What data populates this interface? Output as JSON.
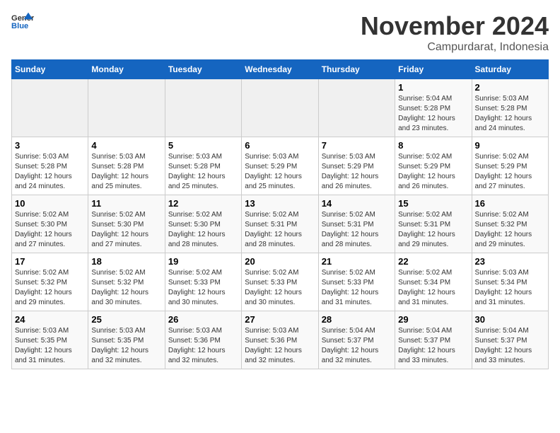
{
  "logo": {
    "line1": "General",
    "line2": "Blue"
  },
  "header": {
    "month": "November 2024",
    "location": "Campurdarat, Indonesia"
  },
  "weekdays": [
    "Sunday",
    "Monday",
    "Tuesday",
    "Wednesday",
    "Thursday",
    "Friday",
    "Saturday"
  ],
  "weeks": [
    [
      {
        "day": "",
        "info": ""
      },
      {
        "day": "",
        "info": ""
      },
      {
        "day": "",
        "info": ""
      },
      {
        "day": "",
        "info": ""
      },
      {
        "day": "",
        "info": ""
      },
      {
        "day": "1",
        "info": "Sunrise: 5:04 AM\nSunset: 5:28 PM\nDaylight: 12 hours and 23 minutes."
      },
      {
        "day": "2",
        "info": "Sunrise: 5:03 AM\nSunset: 5:28 PM\nDaylight: 12 hours and 24 minutes."
      }
    ],
    [
      {
        "day": "3",
        "info": "Sunrise: 5:03 AM\nSunset: 5:28 PM\nDaylight: 12 hours and 24 minutes."
      },
      {
        "day": "4",
        "info": "Sunrise: 5:03 AM\nSunset: 5:28 PM\nDaylight: 12 hours and 25 minutes."
      },
      {
        "day": "5",
        "info": "Sunrise: 5:03 AM\nSunset: 5:28 PM\nDaylight: 12 hours and 25 minutes."
      },
      {
        "day": "6",
        "info": "Sunrise: 5:03 AM\nSunset: 5:29 PM\nDaylight: 12 hours and 25 minutes."
      },
      {
        "day": "7",
        "info": "Sunrise: 5:03 AM\nSunset: 5:29 PM\nDaylight: 12 hours and 26 minutes."
      },
      {
        "day": "8",
        "info": "Sunrise: 5:02 AM\nSunset: 5:29 PM\nDaylight: 12 hours and 26 minutes."
      },
      {
        "day": "9",
        "info": "Sunrise: 5:02 AM\nSunset: 5:29 PM\nDaylight: 12 hours and 27 minutes."
      }
    ],
    [
      {
        "day": "10",
        "info": "Sunrise: 5:02 AM\nSunset: 5:30 PM\nDaylight: 12 hours and 27 minutes."
      },
      {
        "day": "11",
        "info": "Sunrise: 5:02 AM\nSunset: 5:30 PM\nDaylight: 12 hours and 27 minutes."
      },
      {
        "day": "12",
        "info": "Sunrise: 5:02 AM\nSunset: 5:30 PM\nDaylight: 12 hours and 28 minutes."
      },
      {
        "day": "13",
        "info": "Sunrise: 5:02 AM\nSunset: 5:31 PM\nDaylight: 12 hours and 28 minutes."
      },
      {
        "day": "14",
        "info": "Sunrise: 5:02 AM\nSunset: 5:31 PM\nDaylight: 12 hours and 28 minutes."
      },
      {
        "day": "15",
        "info": "Sunrise: 5:02 AM\nSunset: 5:31 PM\nDaylight: 12 hours and 29 minutes."
      },
      {
        "day": "16",
        "info": "Sunrise: 5:02 AM\nSunset: 5:32 PM\nDaylight: 12 hours and 29 minutes."
      }
    ],
    [
      {
        "day": "17",
        "info": "Sunrise: 5:02 AM\nSunset: 5:32 PM\nDaylight: 12 hours and 29 minutes."
      },
      {
        "day": "18",
        "info": "Sunrise: 5:02 AM\nSunset: 5:32 PM\nDaylight: 12 hours and 30 minutes."
      },
      {
        "day": "19",
        "info": "Sunrise: 5:02 AM\nSunset: 5:33 PM\nDaylight: 12 hours and 30 minutes."
      },
      {
        "day": "20",
        "info": "Sunrise: 5:02 AM\nSunset: 5:33 PM\nDaylight: 12 hours and 30 minutes."
      },
      {
        "day": "21",
        "info": "Sunrise: 5:02 AM\nSunset: 5:33 PM\nDaylight: 12 hours and 31 minutes."
      },
      {
        "day": "22",
        "info": "Sunrise: 5:02 AM\nSunset: 5:34 PM\nDaylight: 12 hours and 31 minutes."
      },
      {
        "day": "23",
        "info": "Sunrise: 5:03 AM\nSunset: 5:34 PM\nDaylight: 12 hours and 31 minutes."
      }
    ],
    [
      {
        "day": "24",
        "info": "Sunrise: 5:03 AM\nSunset: 5:35 PM\nDaylight: 12 hours and 31 minutes."
      },
      {
        "day": "25",
        "info": "Sunrise: 5:03 AM\nSunset: 5:35 PM\nDaylight: 12 hours and 32 minutes."
      },
      {
        "day": "26",
        "info": "Sunrise: 5:03 AM\nSunset: 5:36 PM\nDaylight: 12 hours and 32 minutes."
      },
      {
        "day": "27",
        "info": "Sunrise: 5:03 AM\nSunset: 5:36 PM\nDaylight: 12 hours and 32 minutes."
      },
      {
        "day": "28",
        "info": "Sunrise: 5:04 AM\nSunset: 5:37 PM\nDaylight: 12 hours and 32 minutes."
      },
      {
        "day": "29",
        "info": "Sunrise: 5:04 AM\nSunset: 5:37 PM\nDaylight: 12 hours and 33 minutes."
      },
      {
        "day": "30",
        "info": "Sunrise: 5:04 AM\nSunset: 5:37 PM\nDaylight: 12 hours and 33 minutes."
      }
    ]
  ]
}
